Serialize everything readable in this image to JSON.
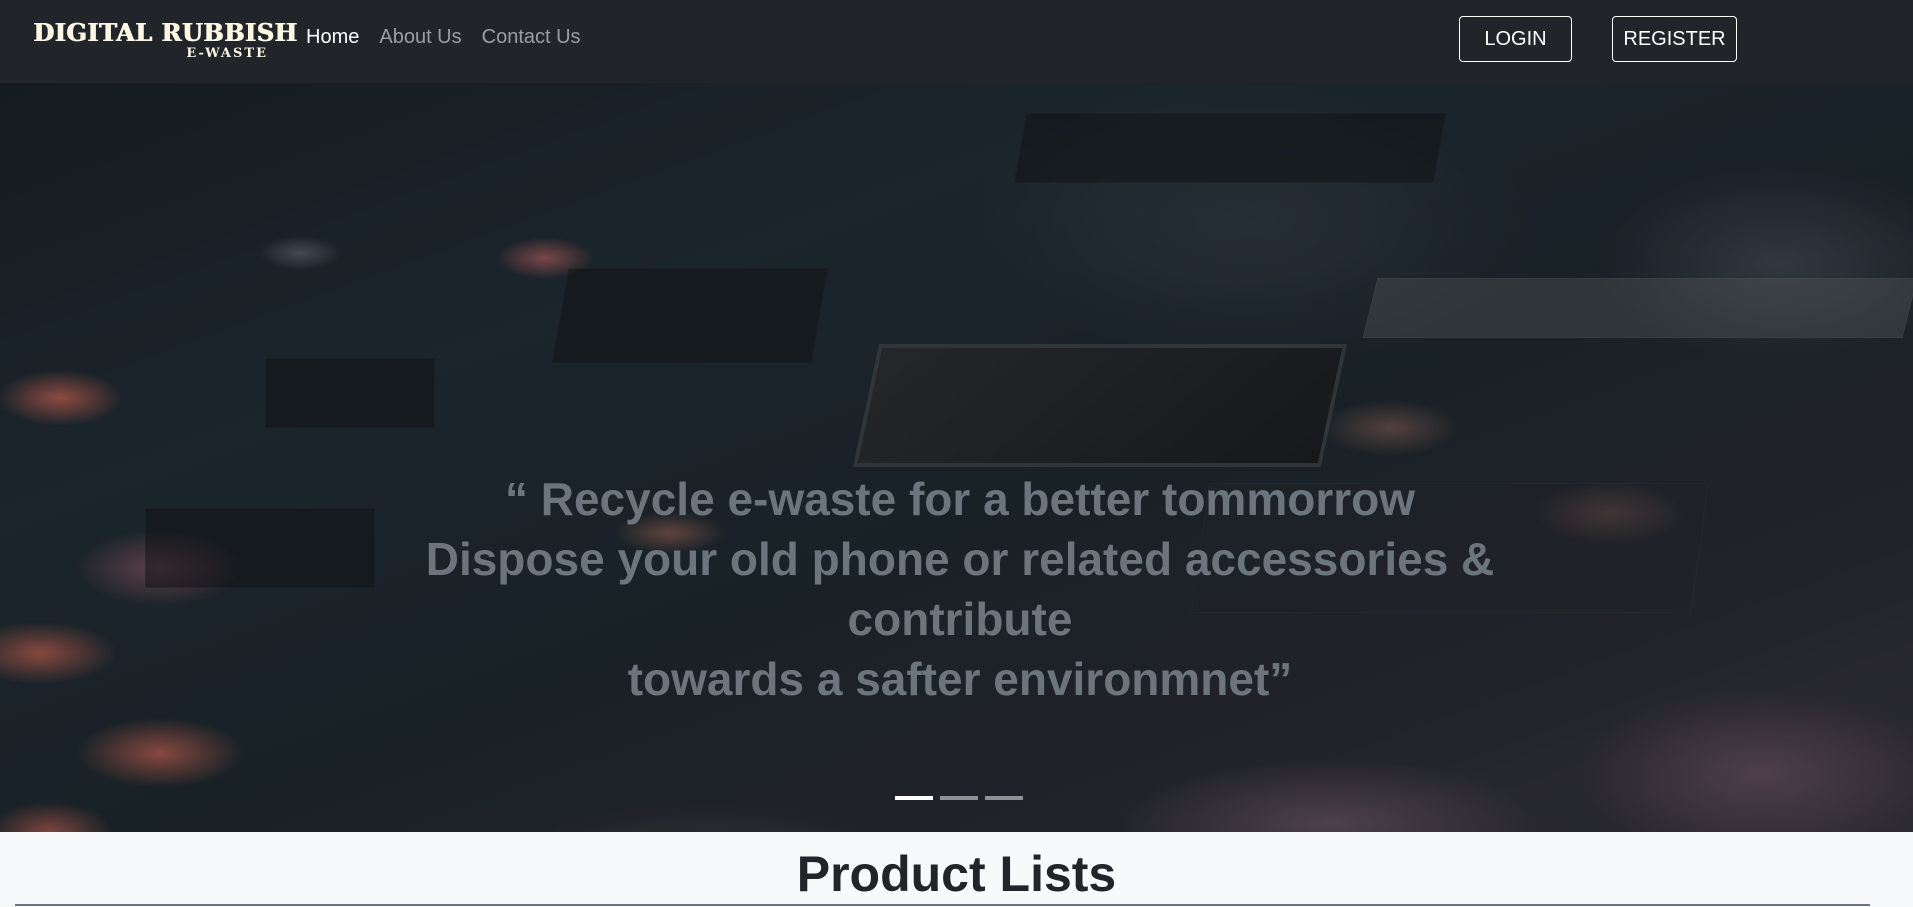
{
  "brand": {
    "name": "DIGITAL RUBBISH",
    "tagline": "E-WASTE"
  },
  "nav": {
    "items": [
      {
        "label": "Home",
        "active": true
      },
      {
        "label": "About Us",
        "active": false
      },
      {
        "label": "Contact Us",
        "active": false
      }
    ],
    "login_label": "LOGIN",
    "register_label": "REGISTER"
  },
  "hero": {
    "quote_lines": [
      "“ Recycle e-waste for a better tommorrow",
      "Dispose your old phone or related accessories &",
      "contribute",
      "towards a safter environmnet”"
    ],
    "slide_count": 3,
    "active_slide": 1
  },
  "products": {
    "heading": "Product Lists"
  },
  "colors": {
    "navbar_bg": "#212529",
    "hero_text": "#6c757d",
    "page_bg": "#f8f9fa",
    "heading": "#212529"
  }
}
